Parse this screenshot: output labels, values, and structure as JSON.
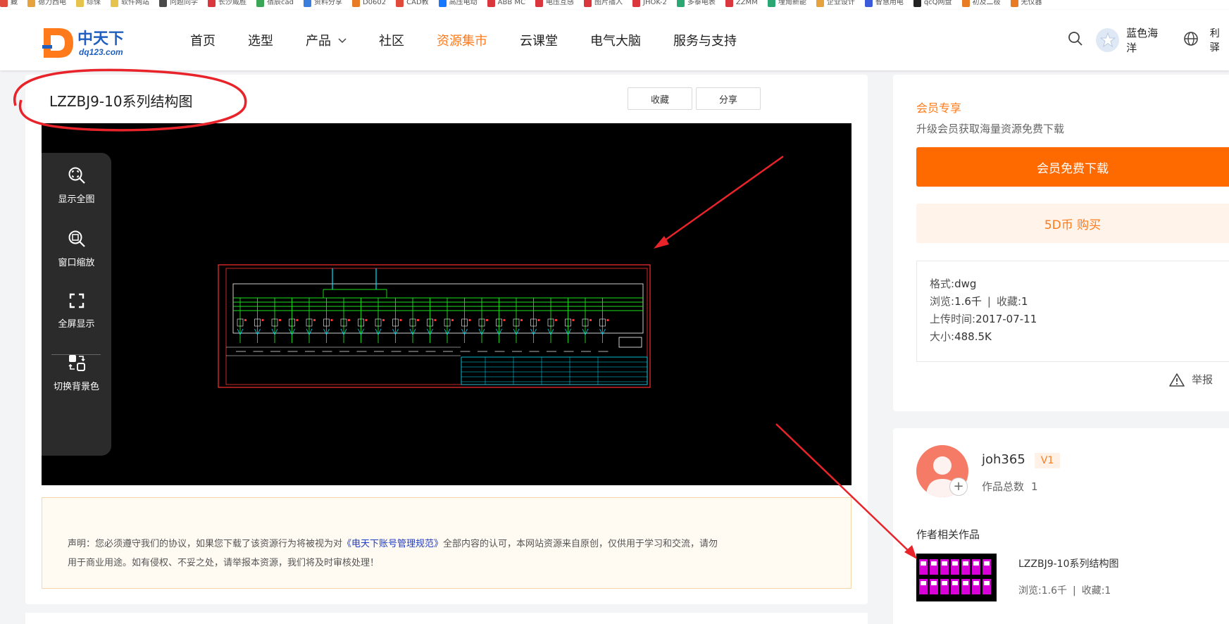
{
  "bookmarks": [
    {
      "label": "藏",
      "color": "#e04b3c"
    },
    {
      "label": "德力西电",
      "color": "#e6a23c"
    },
    {
      "label": "综保",
      "color": "#e6c34c"
    },
    {
      "label": "软件网站",
      "color": "#e6c34c"
    },
    {
      "label": "问题同学",
      "color": "#4a4a4a"
    },
    {
      "label": "长沙威胜",
      "color": "#d9363e"
    },
    {
      "label": "宿辰cad",
      "color": "#3aa757"
    },
    {
      "label": "资料分享",
      "color": "#3b7ddd"
    },
    {
      "label": "D0602",
      "color": "#e87c24"
    },
    {
      "label": "CAD教",
      "color": "#e04b3c"
    },
    {
      "label": "高压电动",
      "color": "#1677ff"
    },
    {
      "label": "ABB MC",
      "color": "#d9363e"
    },
    {
      "label": "电压互感",
      "color": "#d9363e"
    },
    {
      "label": "图片插入",
      "color": "#d9363e"
    },
    {
      "label": "JHOK-2",
      "color": "#d9363e"
    },
    {
      "label": "多泰电表",
      "color": "#2aa772"
    },
    {
      "label": "ZZMM",
      "color": "#d9363e"
    },
    {
      "label": "埋角新能",
      "color": "#2aa772"
    },
    {
      "label": "企业设计",
      "color": "#e6a23c"
    },
    {
      "label": "智慧用电",
      "color": "#3b5bdb"
    },
    {
      "label": "qcQ网盘",
      "color": "#222222"
    },
    {
      "label": "初及二极",
      "color": "#e87c24"
    },
    {
      "label": "无仪器",
      "color": "#e87c24"
    }
  ],
  "header": {
    "logo_text": "中天下",
    "logo_sub": "dq123.com",
    "nav": [
      {
        "label": "首页",
        "active": false
      },
      {
        "label": "选型",
        "active": false
      },
      {
        "label": "产品",
        "active": false,
        "has_dropdown": true
      },
      {
        "label": "社区",
        "active": false
      },
      {
        "label": "资源集市",
        "active": true
      },
      {
        "label": "云课堂",
        "active": false
      },
      {
        "label": "电气大脑",
        "active": false
      },
      {
        "label": "服务与支持",
        "active": false
      }
    ],
    "username": "蓝色海洋",
    "more_label": "利驿"
  },
  "resource": {
    "title": "LZZBJ9-10系列结构图",
    "favorite_label": "收藏",
    "share_label": "分享"
  },
  "viewer_tools": [
    {
      "label": "显示全图",
      "icon": "fit-view-icon"
    },
    {
      "label": "窗口缩放",
      "icon": "window-zoom-icon"
    },
    {
      "label": "全屏显示",
      "icon": "fullscreen-icon"
    },
    {
      "label": "切换背景色",
      "icon": "switch-background-icon"
    }
  ],
  "notice": {
    "prefix": "声明：您必须遵守我们的协议，如果您下载了该资源行为将被视为对",
    "link": "《电天下账号管理规范》",
    "suffix": "全部内容的认可，本网站资源来自原创，仅供用于学习和交流，请勿",
    "line2": "用于商业用途。如有侵权、不妥之处，请举报本资源，我们将及时审核处理！"
  },
  "vip": {
    "title": "会员专享",
    "subtitle": "升级会员获取海量资源免费下载",
    "download_label": "会员免费下载",
    "buy_label": "5D币 购买"
  },
  "meta": {
    "format_label": "格式:",
    "format": "dwg",
    "views_label": "浏览:",
    "views": "1.6千",
    "sep": "|",
    "favorites_label": "收藏:",
    "favorites": "1",
    "upload_label": "上传时间:",
    "upload_time": "2017-07-11",
    "size_label": "大小:",
    "size": "488.5K"
  },
  "report_label": "举报",
  "author": {
    "name": "joh365",
    "level": "V1",
    "works_label": "作品总数",
    "works_count": "1",
    "add_symbol": "+"
  },
  "related": {
    "section_title": "作者相关作品",
    "items": [
      {
        "title": "LZZBJ9-10系列结构图",
        "views_label": "浏览:",
        "views": "1.6千",
        "sep": "|",
        "fav_label": "收藏:",
        "favorites": "1"
      }
    ]
  },
  "colors": {
    "accent": "#ff7a1a",
    "vip_button": "#ff6a00",
    "annotation_red": "#e8232a",
    "cad_green": "#1ee01e",
    "cad_cyan": "#00e5ff",
    "cad_red": "#ff3030"
  }
}
